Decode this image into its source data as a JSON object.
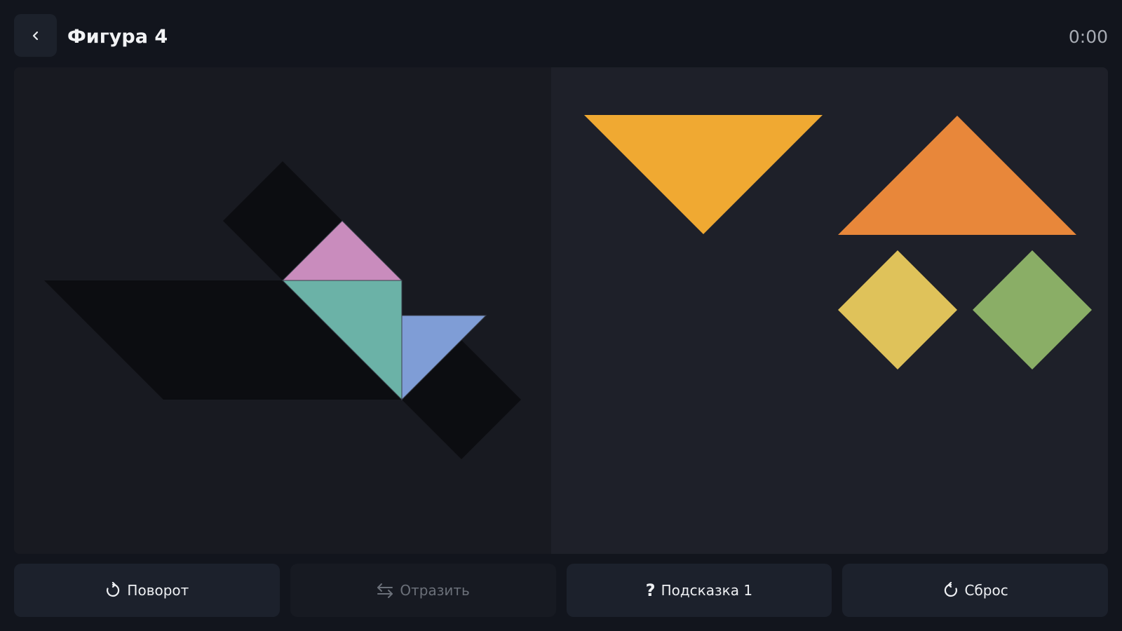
{
  "header": {
    "title": "Фигура 4",
    "timer": "0:00"
  },
  "toolbar": {
    "rotate_label": "Поворот",
    "flip_label": "Отразить",
    "hint_label": "Подсказка 1",
    "hint_icon": "?",
    "reset_label": "Сброс",
    "flip_disabled": true
  },
  "pieces": {
    "large_triangle_yellow": "#f0a932",
    "large_triangle_orange": "#e8873a",
    "square_yellow": "#dfc25a",
    "square_green": "#8aae66",
    "placed_small_triangle_pink": "#c98cbd",
    "placed_medium_triangle_teal": "#6bb2a7",
    "placed_small_triangle_blue": "#7f9dd6"
  },
  "colors": {
    "silhouette": "#0c0d11",
    "panel_left": "#181a21",
    "panel_right": "#1e2029",
    "button_bg": "#1c212c"
  }
}
